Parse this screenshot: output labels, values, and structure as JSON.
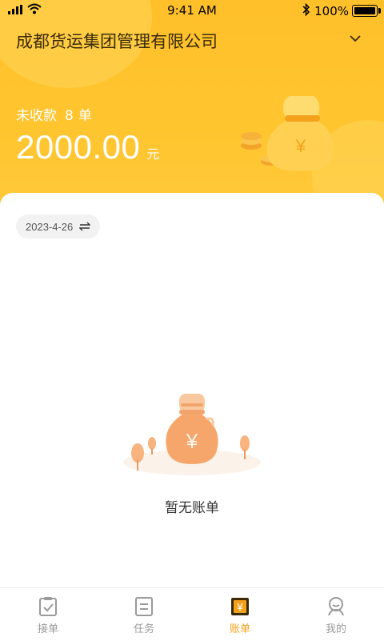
{
  "status": {
    "time": "9:41 AM",
    "battery": "100%"
  },
  "header": {
    "company": "成都货运集团管理有限公司",
    "unpaid_label": "未收款",
    "unpaid_count": "8",
    "unpaid_unit": "单",
    "amount": "2000.00",
    "amount_unit": "元"
  },
  "filter": {
    "date": "2023-4-26"
  },
  "empty": {
    "text": "暂无账单"
  },
  "tabs": [
    {
      "label": "接单",
      "icon": "clipboard-check-icon"
    },
    {
      "label": "任务",
      "icon": "list-icon"
    },
    {
      "label": "账单",
      "icon": "bill-yen-icon"
    },
    {
      "label": "我的",
      "icon": "user-icon"
    }
  ],
  "colors": {
    "accent": "#f4a21c",
    "header": "#ffc02a"
  }
}
